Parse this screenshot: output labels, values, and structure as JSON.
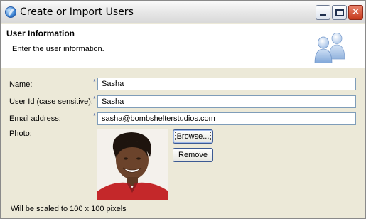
{
  "window": {
    "title": "Create or Import Users"
  },
  "header": {
    "title": "User Information",
    "description": "Enter the user information."
  },
  "form": {
    "name_label": "Name:",
    "name_value": "Sasha",
    "userid_label": "User Id (case sensitive):",
    "userid_value": "Sasha",
    "email_label": "Email address:",
    "email_value": "sasha@bombshelterstudios.com",
    "photo_label": "Photo:",
    "required_marker": "*",
    "browse_label": "Browse...",
    "remove_label": "Remove",
    "scale_note": "Will be scaled to 100 x 100 pixels"
  },
  "icons": {
    "app": "app-icon",
    "minimize": "minimize-icon",
    "maximize": "maximize-icon",
    "close": "close-icon",
    "users": "users-icon",
    "photo": "user-photo"
  }
}
